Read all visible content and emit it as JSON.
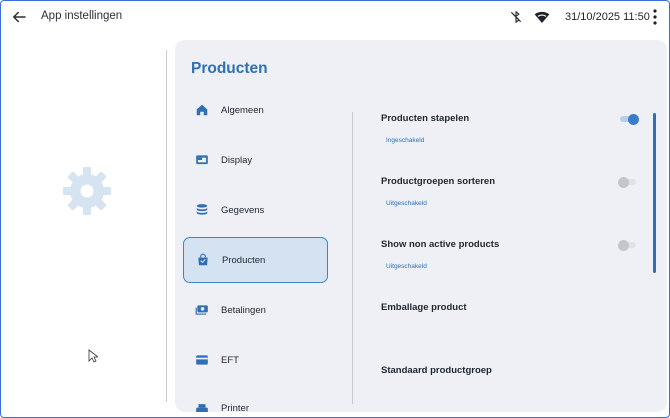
{
  "header": {
    "back_icon": "arrow-left-icon",
    "title": "App instellingen",
    "datetime": "31/10/2025 11:50",
    "icons": [
      "bluetooth-disabled-icon",
      "wifi-icon",
      "more-vertical-icon"
    ]
  },
  "panel": {
    "title": "Producten",
    "nav": [
      {
        "label": "Algemeen",
        "icon": "home-icon"
      },
      {
        "label": "Display",
        "icon": "display-icon"
      },
      {
        "label": "Gegevens",
        "icon": "database-icon"
      },
      {
        "label": "Producten",
        "icon": "shopping-bag-icon",
        "active": true
      },
      {
        "label": "Betalingen",
        "icon": "payments-icon"
      },
      {
        "label": "EFT",
        "icon": "card-icon"
      },
      {
        "label": "Printer",
        "icon": "printer-icon"
      }
    ],
    "settings": [
      {
        "title": "Producten stapelen",
        "status": "Ingeschakeld",
        "toggle": true
      },
      {
        "title": "Productgroepen sorteren",
        "status": "Uitgeschakeld",
        "toggle": false
      },
      {
        "title": "Show non active products",
        "status": "Uitgeschakeld",
        "toggle": false
      },
      {
        "title": "Emballage product"
      },
      {
        "title": "Standaard productgroep"
      }
    ]
  },
  "colors": {
    "accent": "#2f6fb3",
    "toggle_on": "#3a7ccc",
    "active_nav_bg": "#d4e2f1",
    "panel_bg": "#eef0f5",
    "placeholder_gear": "#d6e3f0"
  }
}
